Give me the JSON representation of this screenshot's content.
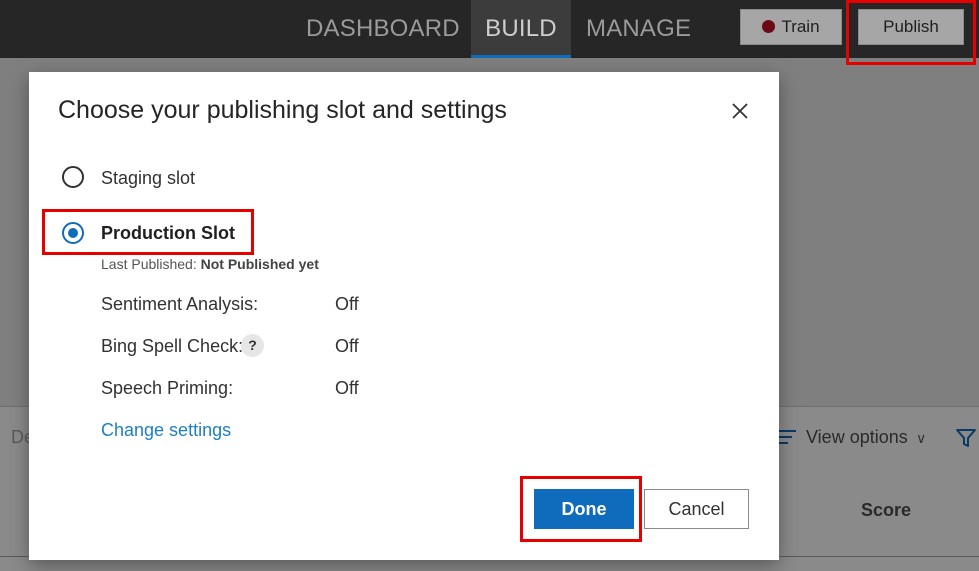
{
  "nav": {
    "tabs": [
      {
        "label": "DASHBOARD"
      },
      {
        "label": "BUILD",
        "active": true
      },
      {
        "label": "MANAGE"
      }
    ],
    "train_label": "Train",
    "publish_label": "Publish"
  },
  "background": {
    "truncated_text": "De",
    "view_options": "View options",
    "score_header": "Score"
  },
  "dialog": {
    "title": "Choose your publishing slot and settings",
    "slots": {
      "staging": {
        "label": "Staging slot",
        "selected": false
      },
      "production": {
        "label": "Production Slot",
        "selected": true
      }
    },
    "last_published_label": "Last Published:",
    "last_published_value": "Not Published yet",
    "settings": [
      {
        "label": "Sentiment Analysis:",
        "value": "Off"
      },
      {
        "label": "Bing Spell Check:",
        "value": "Off",
        "help": "?"
      },
      {
        "label": "Speech Priming:",
        "value": "Off"
      }
    ],
    "change_settings": "Change settings",
    "done_label": "Done",
    "cancel_label": "Cancel"
  },
  "colors": {
    "accent": "#0f6cbd",
    "highlight": "#e60000",
    "link": "#1d7fc1"
  }
}
